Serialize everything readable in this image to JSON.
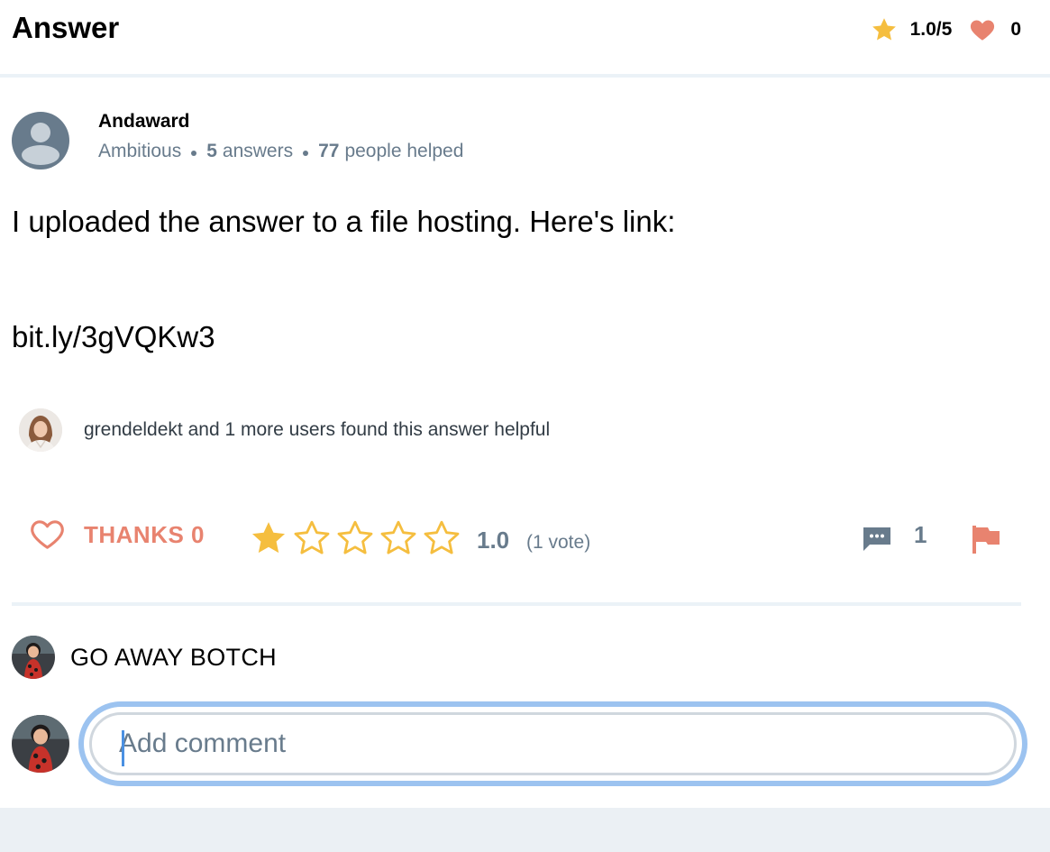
{
  "header": {
    "title": "Answer",
    "rating": "1.0/5",
    "thanks_count": "0"
  },
  "author": {
    "name": "Andaward",
    "rank": "Ambitious",
    "answers_count": "5",
    "answers_label": "answers",
    "helped_count": "77",
    "helped_label": "people helped"
  },
  "answer": {
    "line1": "I uploaded the answer to a file hosting. Here's link:",
    "line2": "bit.ly/3gVQKw3"
  },
  "helpful": {
    "text": "grendeldekt and 1 more users found this answer helpful"
  },
  "actions": {
    "thanks_label": "THANKS 0",
    "rating_value": "1.0",
    "rating_votes": "(1 vote)",
    "stars_filled": 1,
    "stars_total": 5,
    "comments_count": "1"
  },
  "comments": [
    {
      "text": "GO AWAY BOTCH"
    }
  ],
  "comment_input": {
    "placeholder": "Add comment",
    "value": ""
  },
  "colors": {
    "accent_star": "#f5be3f",
    "accent_heart": "#e8836f",
    "text_muted": "#687b8c",
    "focus_ring": "#9cc3f0"
  },
  "icons": {
    "header_star": "star-icon",
    "header_heart": "heart-icon",
    "thanks": "heart-outline-icon",
    "comments": "speech-bubble-icon",
    "report": "flag-icon"
  }
}
